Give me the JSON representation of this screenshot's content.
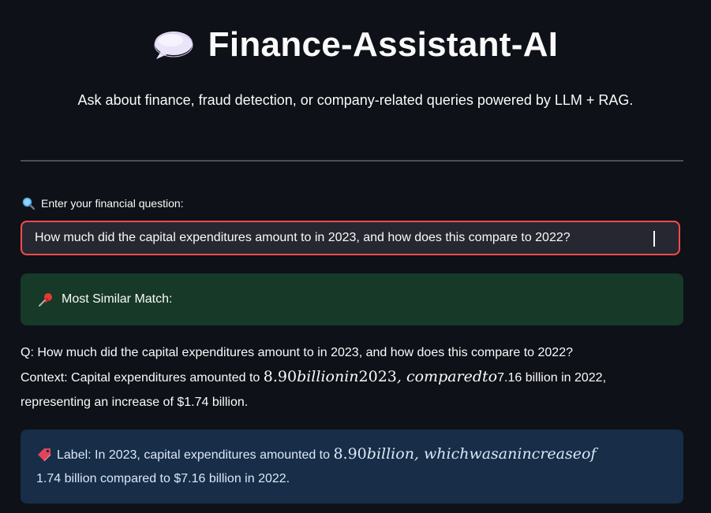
{
  "header": {
    "title": "Finance-Assistant-AI",
    "title_icon": "speech-balloon-icon",
    "subtitle": "Ask about finance, fraud detection, or company-related queries powered by LLM + RAG."
  },
  "query": {
    "label_icon": "magnifier-icon",
    "label": "Enter your financial question:",
    "value": "How much did the capital expenditures amount to in 2023, and how does this compare to 2022?"
  },
  "match": {
    "icon": "pushpin-icon",
    "heading": "Most Similar Match:"
  },
  "result": {
    "question_line": "Q: How much did the capital expenditures amount to in 2023, and how does this compare to 2022?",
    "context_prefix": "Context: Capital expenditures amounted to ",
    "context_math_num": "8.90",
    "context_math_text": "billionin",
    "context_math_year": "2023",
    "context_math_tail": ", comparedto",
    "context_suffix": "7.16 billion in 2022,",
    "context_line3": "representing an increase of $1.74 billion."
  },
  "label": {
    "icon": "label-tag-icon",
    "prefix": "Label: In 2023, capital expenditures amounted to ",
    "math_num": "8.90",
    "math_text": "billion, whichwasanincreaseof",
    "line2": "1.74 billion compared to $7.16 billion in 2022."
  },
  "colors": {
    "background": "#0e1117",
    "input_border": "#ff4b4b",
    "success_bg": "#173928",
    "info_bg": "#172d48"
  }
}
